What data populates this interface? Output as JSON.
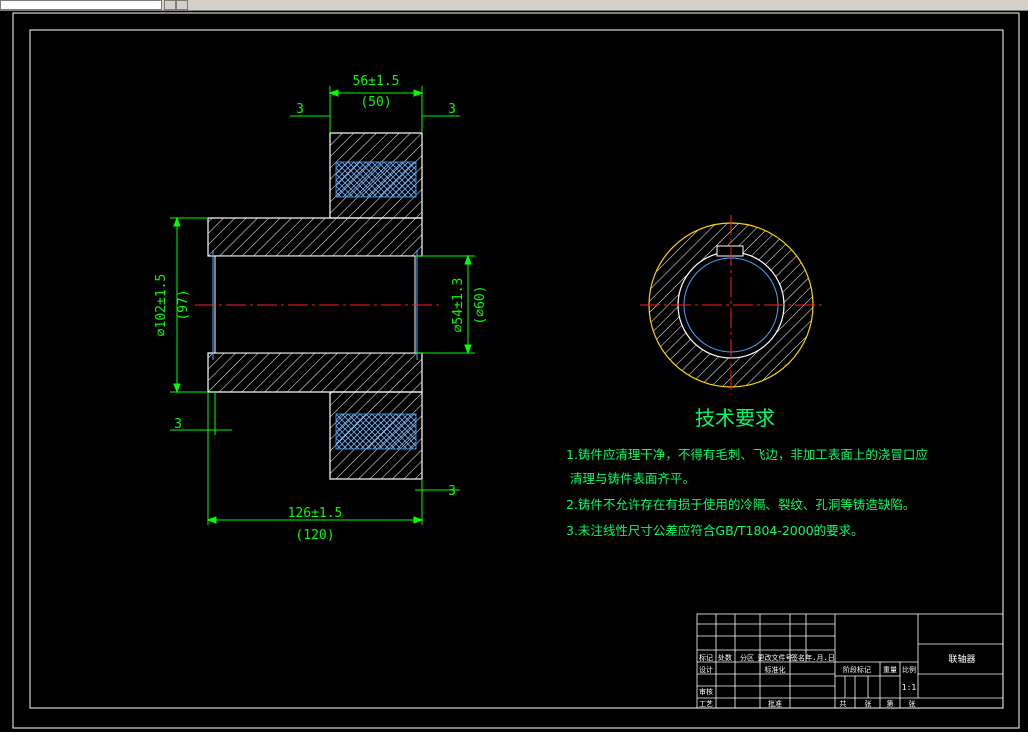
{
  "drawing": {
    "dims": {
      "top_width": "56±1.5",
      "top_width_ref": "(50)",
      "left_3": "3",
      "right_3": "3",
      "outer_dia": "⌀102±1.5",
      "outer_dia_ref": "(97)",
      "bore_dia": "⌀54±1.3",
      "bore_dia_ref": "(⌀60)",
      "bottom_left_3": "3",
      "bottom_right_3": "3",
      "total_len": "126±1.5",
      "total_len_ref": "(120)"
    },
    "notes": {
      "title": "技术要求",
      "line1": "1.铸件应清理干净，不得有毛刺、飞边，非加工表面上的浇冒口应",
      "line1b": "清理与铸件表面齐平。",
      "line2": "2.铸件不允许存在有损于使用的冷隔、裂纹、孔洞等铸造缺陷。",
      "line3": "3.未注线性尺寸公差应符合GB/T1804-2000的要求。"
    },
    "titleblock": {
      "part_name": "联轴器",
      "scale": "1:1",
      "labels": [
        "标记",
        "处数",
        "分区",
        "更改文件号",
        "签名",
        "年.月.日",
        "设计",
        "标准化",
        "阶段标记",
        "重量",
        "比例",
        "审核",
        "工艺",
        "批准",
        "共",
        "张",
        "第",
        "张"
      ]
    }
  },
  "colors": {
    "background": "#000000",
    "outline": "#ffffff",
    "hatch": "#ffffff",
    "dimension": "#00ff00",
    "centerline": "#ff2020",
    "text_green": "#00ff66",
    "cross_hatch": "#4aa3ff"
  }
}
